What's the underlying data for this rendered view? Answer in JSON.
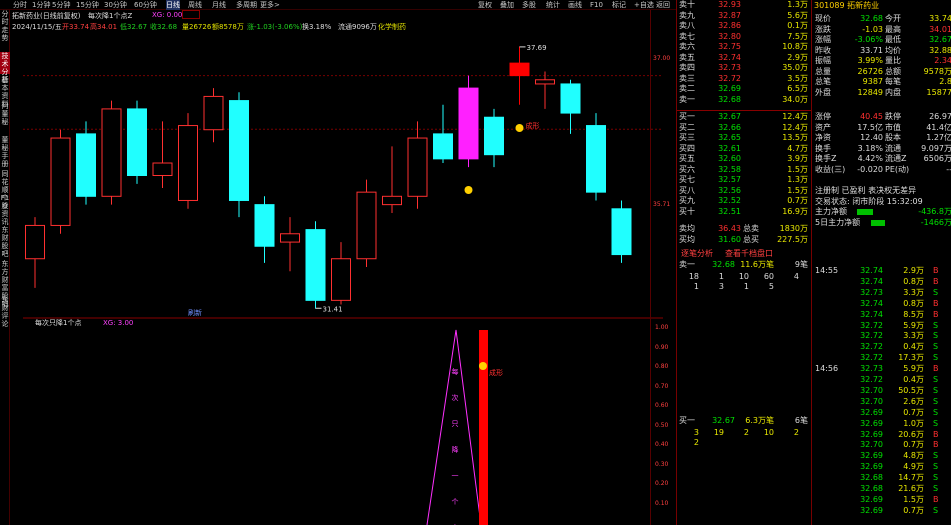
{
  "toolbar": {
    "items": [
      "分时",
      "1分钟",
      "5分钟",
      "15分钟",
      "30分钟",
      "60分钟",
      "日线",
      "周线",
      "月线",
      "多周期",
      "更多>"
    ],
    "right": [
      "复权",
      "叠加",
      "多股",
      "统计",
      "画线",
      "F10",
      "标记",
      "+自选",
      "返回"
    ],
    "active": "日线"
  },
  "left_tabs": [
    "分时走势",
    "技术分析",
    "基本资料",
    "问董秘",
    "董秘手册",
    "同花顺F10",
    "个股资讯",
    "东财股吧",
    "东方财富股吧",
    "东财评论"
  ],
  "left_tab_active": "技术分析",
  "info": {
    "stock": "拓新药业(日线前复权)",
    "formula": "每次降1个点Z",
    "xg": "XG: 0.00",
    "date": "2024/11/15/五",
    "open": "开33.74",
    "high": "高34.01",
    "low": "低32.67",
    "close": "收32.68",
    "volume": "量26726",
    "amount": "额8578万",
    "change": "涨-1.03(-3.06%)",
    "turnover": "换3.18%",
    "float": "流通9096万",
    "sector": "化学制药"
  },
  "chart": {
    "high_label": "37.69",
    "low_label": "31.41",
    "sig1": "成形",
    "sig2": "刷新",
    "sub_title": "每次只降1个点",
    "sub_xg": "XG: 3.00",
    "sub_text": "每次只降一个点",
    "sub_sig": "成形",
    "scale_main": [
      "37.00",
      "35.71"
    ],
    "scale_sub": [
      "1.00",
      "0.90",
      "0.80",
      "0.70",
      "0.60",
      "0.50",
      "0.40",
      "0.30",
      "0.20",
      "0.10"
    ]
  },
  "candles": [
    {
      "o": 32.6,
      "c": 33.4,
      "h": 33.6,
      "l": 31.9
    },
    {
      "o": 33.4,
      "c": 35.5,
      "h": 35.7,
      "l": 33.2
    },
    {
      "o": 35.6,
      "c": 34.1,
      "h": 35.9,
      "l": 33.9
    },
    {
      "o": 34.1,
      "c": 36.2,
      "h": 36.4,
      "l": 33.9
    },
    {
      "o": 36.2,
      "c": 34.6,
      "h": 36.4,
      "l": 34.4
    },
    {
      "o": 34.6,
      "c": 34.9,
      "h": 35.9,
      "l": 34.3
    },
    {
      "o": 34.0,
      "c": 35.8,
      "h": 36.1,
      "l": 33.8
    },
    {
      "o": 35.7,
      "c": 36.5,
      "h": 36.7,
      "l": 35.4
    },
    {
      "o": 36.4,
      "c": 34.0,
      "h": 36.6,
      "l": 33.6
    },
    {
      "o": 33.9,
      "c": 32.9,
      "h": 34.1,
      "l": 32.5
    },
    {
      "o": 33.0,
      "c": 33.2,
      "h": 33.6,
      "l": 32.3
    },
    {
      "o": 33.3,
      "c": 31.6,
      "h": 33.5,
      "l": 31.4
    },
    {
      "o": 31.6,
      "c": 32.6,
      "h": 33.0,
      "l": 31.5
    },
    {
      "o": 32.6,
      "c": 34.2,
      "h": 34.5,
      "l": 32.4
    },
    {
      "o": 33.9,
      "c": 34.1,
      "h": 35.3,
      "l": 33.7
    },
    {
      "o": 34.1,
      "c": 35.5,
      "h": 35.9,
      "l": 33.8
    },
    {
      "o": 35.6,
      "c": 35.0,
      "h": 36.3,
      "l": 34.9
    },
    {
      "o": 35.0,
      "c": 36.7,
      "h": 37.0,
      "l": 34.8
    },
    {
      "o": 36.0,
      "c": 35.1,
      "h": 36.2,
      "l": 34.8
    },
    {
      "o": 37.0,
      "c": 37.3,
      "h": 37.7,
      "l": 36.3
    },
    {
      "o": 36.8,
      "c": 36.9,
      "h": 37.1,
      "l": 36.2
    },
    {
      "o": 36.8,
      "c": 36.1,
      "h": 36.9,
      "l": 35.6
    },
    {
      "o": 35.8,
      "c": 34.2,
      "h": 36.1,
      "l": 34.0
    },
    {
      "o": 33.8,
      "c": 32.7,
      "h": 34.0,
      "l": 32.5
    }
  ],
  "quote": {
    "title": "301089 拓新药业",
    "asks": [
      [
        "卖十",
        "32.93",
        "1.3万"
      ],
      [
        "卖九",
        "32.87",
        "5.6万"
      ],
      [
        "卖八",
        "32.86",
        "0.1万"
      ],
      [
        "卖七",
        "32.80",
        "7.5万"
      ],
      [
        "卖六",
        "32.75",
        "10.8万"
      ],
      [
        "卖五",
        "32.74",
        "2.9万"
      ],
      [
        "卖四",
        "32.73",
        "35.0万"
      ],
      [
        "卖三",
        "32.72",
        "3.5万"
      ],
      [
        "卖二",
        "32.69",
        "6.5万"
      ],
      [
        "卖一",
        "32.68",
        "34.0万"
      ]
    ],
    "bids": [
      [
        "买一",
        "32.67",
        "12.4万"
      ],
      [
        "买二",
        "32.66",
        "12.4万"
      ],
      [
        "买三",
        "32.65",
        "13.5万"
      ],
      [
        "买四",
        "32.61",
        "4.7万"
      ],
      [
        "买五",
        "32.60",
        "3.9万"
      ],
      [
        "买六",
        "32.58",
        "1.5万"
      ],
      [
        "买七",
        "32.57",
        "1.3万"
      ],
      [
        "买八",
        "32.56",
        "1.5万"
      ],
      [
        "买九",
        "32.52",
        "0.7万"
      ],
      [
        "买十",
        "32.51",
        "16.9万"
      ]
    ],
    "stats": [
      [
        "现价",
        "32.68",
        "今开",
        "33.74"
      ],
      [
        "涨跌",
        "-1.03",
        "最高",
        "34.01"
      ],
      [
        "涨幅",
        "-3.06%",
        "最低",
        "32.67"
      ],
      [
        "昨收",
        "33.71",
        "均价",
        "32.88"
      ],
      [
        "振幅",
        "3.99%",
        "量比",
        "2.34"
      ],
      [
        "总量",
        "26726",
        "总额",
        "9578万"
      ],
      [
        "总笔",
        "9387",
        "每笔",
        "2.8"
      ],
      [
        "外盘",
        "12849",
        "内盘",
        "15877"
      ]
    ],
    "stats2": [
      [
        "涨停",
        "40.45",
        "跌停",
        "26.97"
      ],
      [
        "资产",
        "17.5亿",
        "市值",
        "41.4亿"
      ],
      [
        "净资",
        "12.40",
        "股本",
        "1.27亿"
      ],
      [
        "换手",
        "3.18%",
        "流通",
        "9.097万"
      ],
      [
        "换手Z",
        "4.42%",
        "流通Z",
        "6506万"
      ],
      [
        "收益(三)",
        "-0.020",
        "PE(动)",
        "--"
      ]
    ],
    "notes": [
      "注册制 已盈利 表决权无差异",
      "交易状态: 闭市阶段 15:32:09"
    ],
    "flow": [
      [
        "主力净额",
        "-436.8万"
      ],
      [
        "5日主力净额",
        "-1466万"
      ]
    ],
    "avg": [
      [
        "卖均",
        "36.43",
        "总卖",
        "1830万"
      ],
      [
        "买均",
        "31.60",
        "总买",
        "227.5万"
      ]
    ],
    "tabs": [
      "逐笔分析",
      "查看千档盘口"
    ],
    "ask1": [
      "卖一",
      "32.68",
      "11.6万笔",
      "9笔"
    ],
    "ask1_q": [
      [
        "18",
        "1",
        "10",
        "60",
        "4"
      ],
      [
        "1",
        "3",
        "1",
        "5",
        ""
      ]
    ],
    "bid1": [
      "买一",
      "32.67",
      "6.3万笔",
      "6笔"
    ],
    "bid1_q": [
      [
        "3",
        "19",
        "2",
        "10",
        "2"
      ],
      [
        "2",
        "",
        "",
        "",
        ""
      ]
    ],
    "ticks": [
      [
        "14:55",
        "32.74",
        "2.9万",
        "B"
      ],
      [
        "",
        "32.74",
        "0.8万",
        "B"
      ],
      [
        "",
        "32.73",
        "3.3万",
        "S"
      ],
      [
        "",
        "32.74",
        "0.8万",
        "B"
      ],
      [
        "",
        "32.74",
        "8.5万",
        "B"
      ],
      [
        "",
        "32.72",
        "5.9万",
        "S"
      ],
      [
        "",
        "32.72",
        "3.3万",
        "S"
      ],
      [
        "",
        "32.72",
        "0.4万",
        "S"
      ],
      [
        "",
        "32.72",
        "17.3万",
        "S"
      ],
      [
        "14:56",
        "32.73",
        "5.9万",
        "B"
      ],
      [
        "",
        "32.72",
        "0.4万",
        "S"
      ],
      [
        "",
        "32.70",
        "50.5万",
        "S"
      ],
      [
        "",
        "32.70",
        "2.6万",
        "S"
      ],
      [
        "",
        "32.69",
        "0.7万",
        "S"
      ],
      [
        "",
        "32.69",
        "1.0万",
        "S"
      ],
      [
        "",
        "32.69",
        "20.6万",
        "B"
      ],
      [
        "",
        "32.70",
        "0.7万",
        "B"
      ],
      [
        "",
        "32.69",
        "4.8万",
        "S"
      ],
      [
        "",
        "32.69",
        "4.9万",
        "S"
      ],
      [
        "",
        "32.68",
        "14.7万",
        "S"
      ],
      [
        "",
        "32.68",
        "21.6万",
        "S"
      ],
      [
        "",
        "32.69",
        "1.5万",
        "B"
      ],
      [
        "",
        "32.69",
        "0.7万",
        "S"
      ]
    ]
  }
}
